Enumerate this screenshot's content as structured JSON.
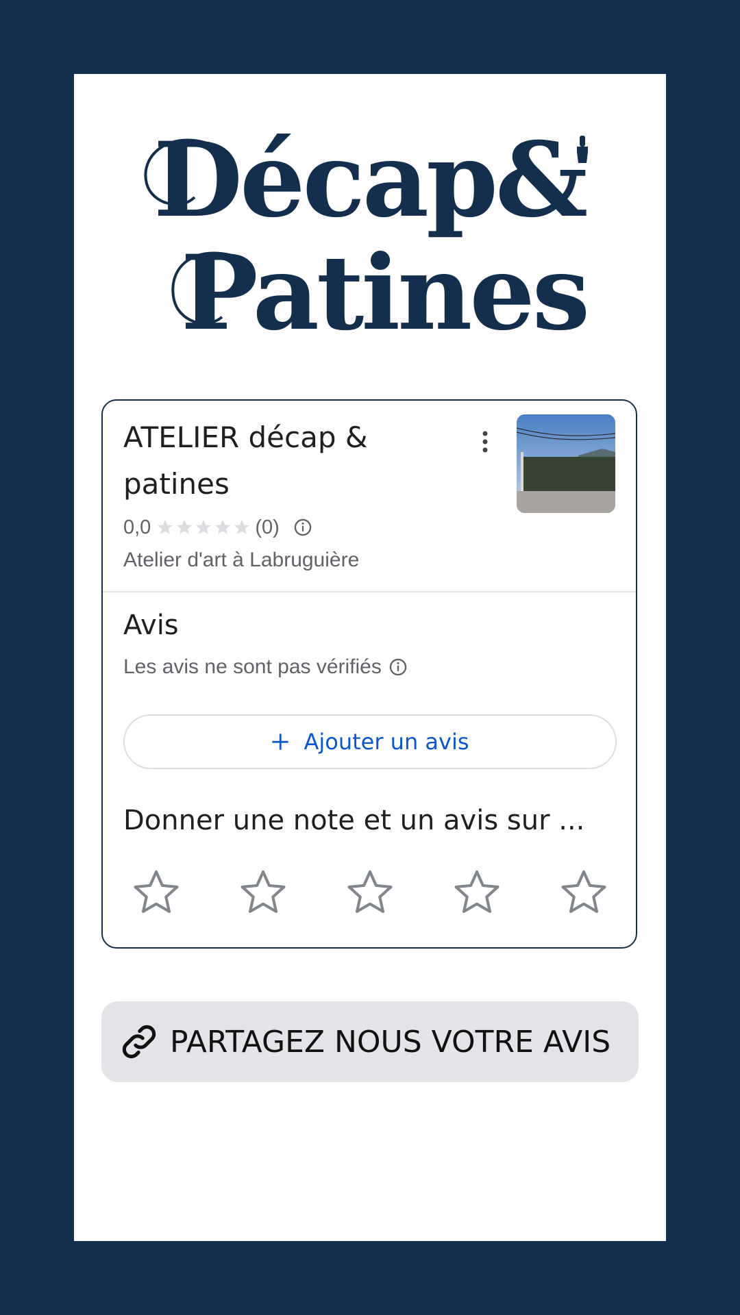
{
  "logo": {
    "line1": "Décap&",
    "line2": "Patines"
  },
  "place": {
    "title": "ATELIER décap & patines",
    "rating": "0,0",
    "rating_count": "(0)",
    "category": "Atelier d'art à Labruguière",
    "thumbnail_icon": "place-photo"
  },
  "reviews": {
    "heading": "Avis",
    "note": "Les avis ne sont pas vérifiés",
    "add_button": "Ajouter un avis",
    "rate_heading": "Donner une note et un avis sur ...",
    "star_count": 5
  },
  "share": {
    "label": "PARTAGEZ NOUS VOTRE AVIS",
    "icon": "link-icon"
  },
  "colors": {
    "background": "#142e4d",
    "accent_blue": "#0b57d0",
    "share_bg": "#e3e4e8"
  }
}
